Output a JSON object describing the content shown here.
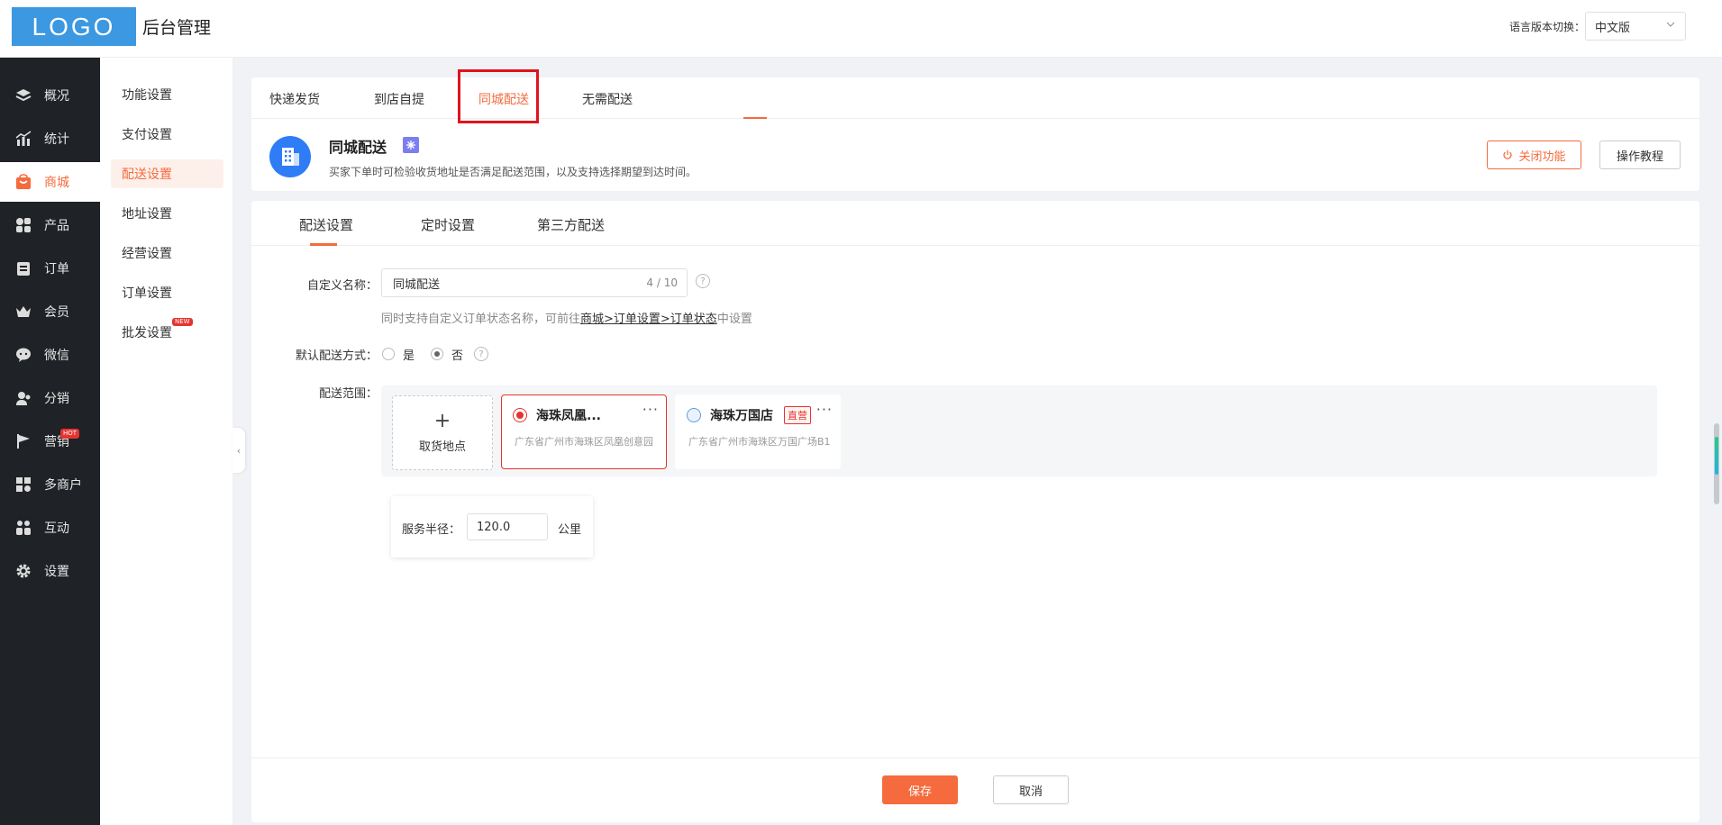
{
  "header": {
    "logo": "LOGO",
    "title": "后台管理",
    "lang_label": "语言版本切换：",
    "lang_value": "中文版"
  },
  "sidebar": {
    "items": [
      {
        "label": "概况",
        "icon": "layers-icon"
      },
      {
        "label": "统计",
        "icon": "chart-icon"
      },
      {
        "label": "商城",
        "icon": "shop-icon"
      },
      {
        "label": "产品",
        "icon": "product-icon"
      },
      {
        "label": "订单",
        "icon": "order-icon"
      },
      {
        "label": "会员",
        "icon": "crown-icon"
      },
      {
        "label": "微信",
        "icon": "wechat-icon"
      },
      {
        "label": "分销",
        "icon": "distribution-icon"
      },
      {
        "label": "营销",
        "icon": "flag-icon",
        "badge": "HOT"
      },
      {
        "label": "多商户",
        "icon": "merchant-icon"
      },
      {
        "label": "互动",
        "icon": "interact-icon"
      },
      {
        "label": "设置",
        "icon": "gear-icon"
      }
    ],
    "active_index": 2
  },
  "subsidebar": {
    "items": [
      {
        "label": "功能设置"
      },
      {
        "label": "支付设置"
      },
      {
        "label": "配送设置"
      },
      {
        "label": "地址设置"
      },
      {
        "label": "经营设置"
      },
      {
        "label": "订单设置"
      },
      {
        "label": "批发设置",
        "badge": "NEW"
      }
    ],
    "active_index": 2
  },
  "top_tabs": {
    "items": [
      "快递发货",
      "到店自提",
      "同城配送",
      "无需配送"
    ],
    "active_index": 2
  },
  "feature": {
    "title": "同城配送",
    "description": "买家下单时可检验收货地址是否满足配送范围，以及支持选择期望到达时间。",
    "close_button": "关闭功能",
    "tutorial_button": "操作教程"
  },
  "sub_tabs": {
    "items": [
      "配送设置",
      "定时设置",
      "第三方配送"
    ],
    "active_index": 0
  },
  "form": {
    "name_label": "自定义名称：",
    "name_value": "同城配送",
    "name_count": "4 / 10",
    "hint_prefix": "同时支持自定义订单状态名称，可前往",
    "hint_link": "商城>订单设置>订单状态",
    "hint_suffix": "中设置",
    "default_label": "默认配送方式：",
    "option_yes": "是",
    "option_no": "否",
    "default_value": "否",
    "range_label": "配送范围：",
    "add_location": "取货地点",
    "locations": [
      {
        "name": "海珠凤凰...",
        "address": "广东省广州市海珠区凤凰创意园",
        "selected": true,
        "tag": ""
      },
      {
        "name": "海珠万国店",
        "address": "广东省广州市海珠区万国广场B1",
        "selected": false,
        "tag": "直营"
      }
    ],
    "radius_label": "服务半径：",
    "radius_value": "120.0",
    "radius_unit": "公里"
  },
  "footer": {
    "save": "保存",
    "cancel": "取消"
  },
  "colors": {
    "accent": "#f56b3d",
    "sidebar_bg": "#1f2227",
    "logo_bg": "#3c98e0",
    "highlight_box": "#e0141e"
  }
}
